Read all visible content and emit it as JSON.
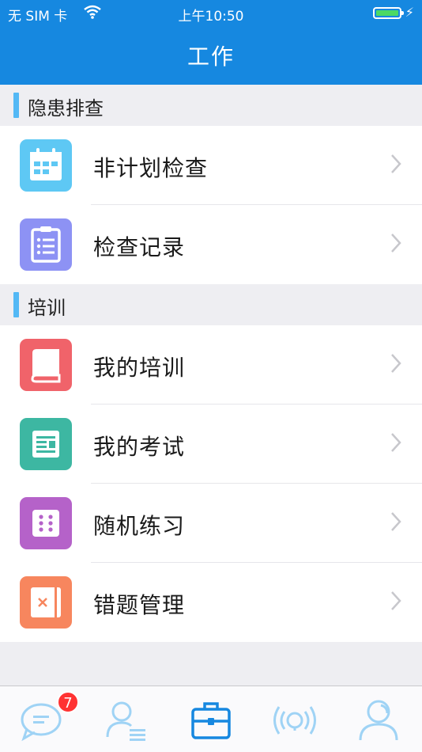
{
  "status_bar": {
    "carrier": "无 SIM 卡",
    "time": "上午10:50"
  },
  "header": {
    "title": "工作"
  },
  "sections": [
    {
      "label": "隐患排查",
      "items": [
        {
          "label": "非计划检查",
          "icon": "calendar-icon",
          "color": "#5ec8f4"
        },
        {
          "label": "检查记录",
          "icon": "clipboard-list-icon",
          "color": "#8d92f4"
        }
      ]
    },
    {
      "label": "培训",
      "items": [
        {
          "label": "我的培训",
          "icon": "book-icon",
          "color": "#f0636a"
        },
        {
          "label": "我的考试",
          "icon": "exam-paper-icon",
          "color": "#3db7a2"
        },
        {
          "label": "随机练习",
          "icon": "dice-icon",
          "color": "#b562c9"
        },
        {
          "label": "错题管理",
          "icon": "wrong-answer-notebook-icon",
          "color": "#f7865e"
        }
      ]
    }
  ],
  "tabbar": {
    "messages_badge": "7",
    "tabs": [
      {
        "icon": "chat-bubble-icon",
        "active": false
      },
      {
        "icon": "contacts-icon",
        "active": false
      },
      {
        "icon": "briefcase-icon",
        "active": true
      },
      {
        "icon": "broadcast-icon",
        "active": false
      },
      {
        "icon": "profile-icon",
        "active": false
      }
    ],
    "active_color": "#1688e0",
    "inactive_color": "#9fd3f5"
  }
}
